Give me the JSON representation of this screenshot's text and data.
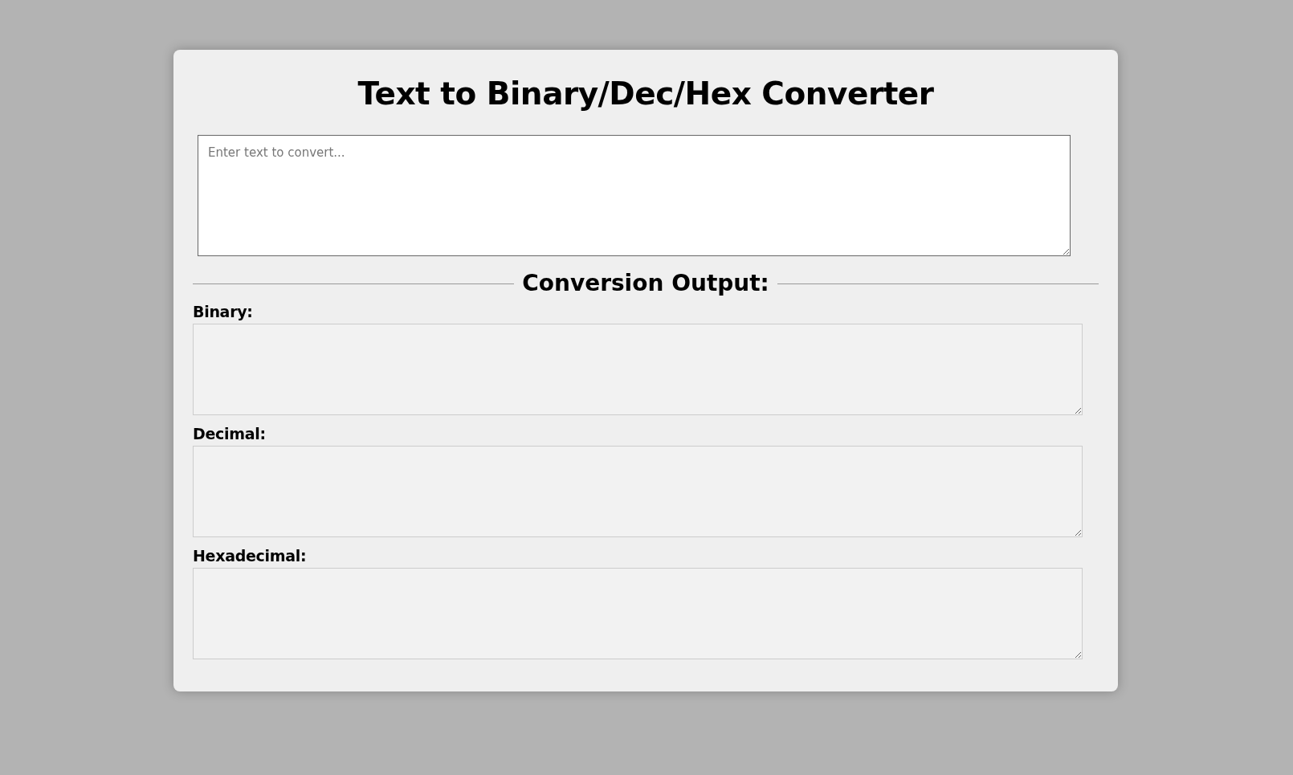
{
  "title": "Text to Binary/Dec/Hex Converter",
  "input": {
    "placeholder": "Enter text to convert..."
  },
  "output_heading": "Conversion Output:",
  "outputs": [
    {
      "label": "Binary:"
    },
    {
      "label": "Decimal:"
    },
    {
      "label": "Hexadecimal:"
    }
  ]
}
